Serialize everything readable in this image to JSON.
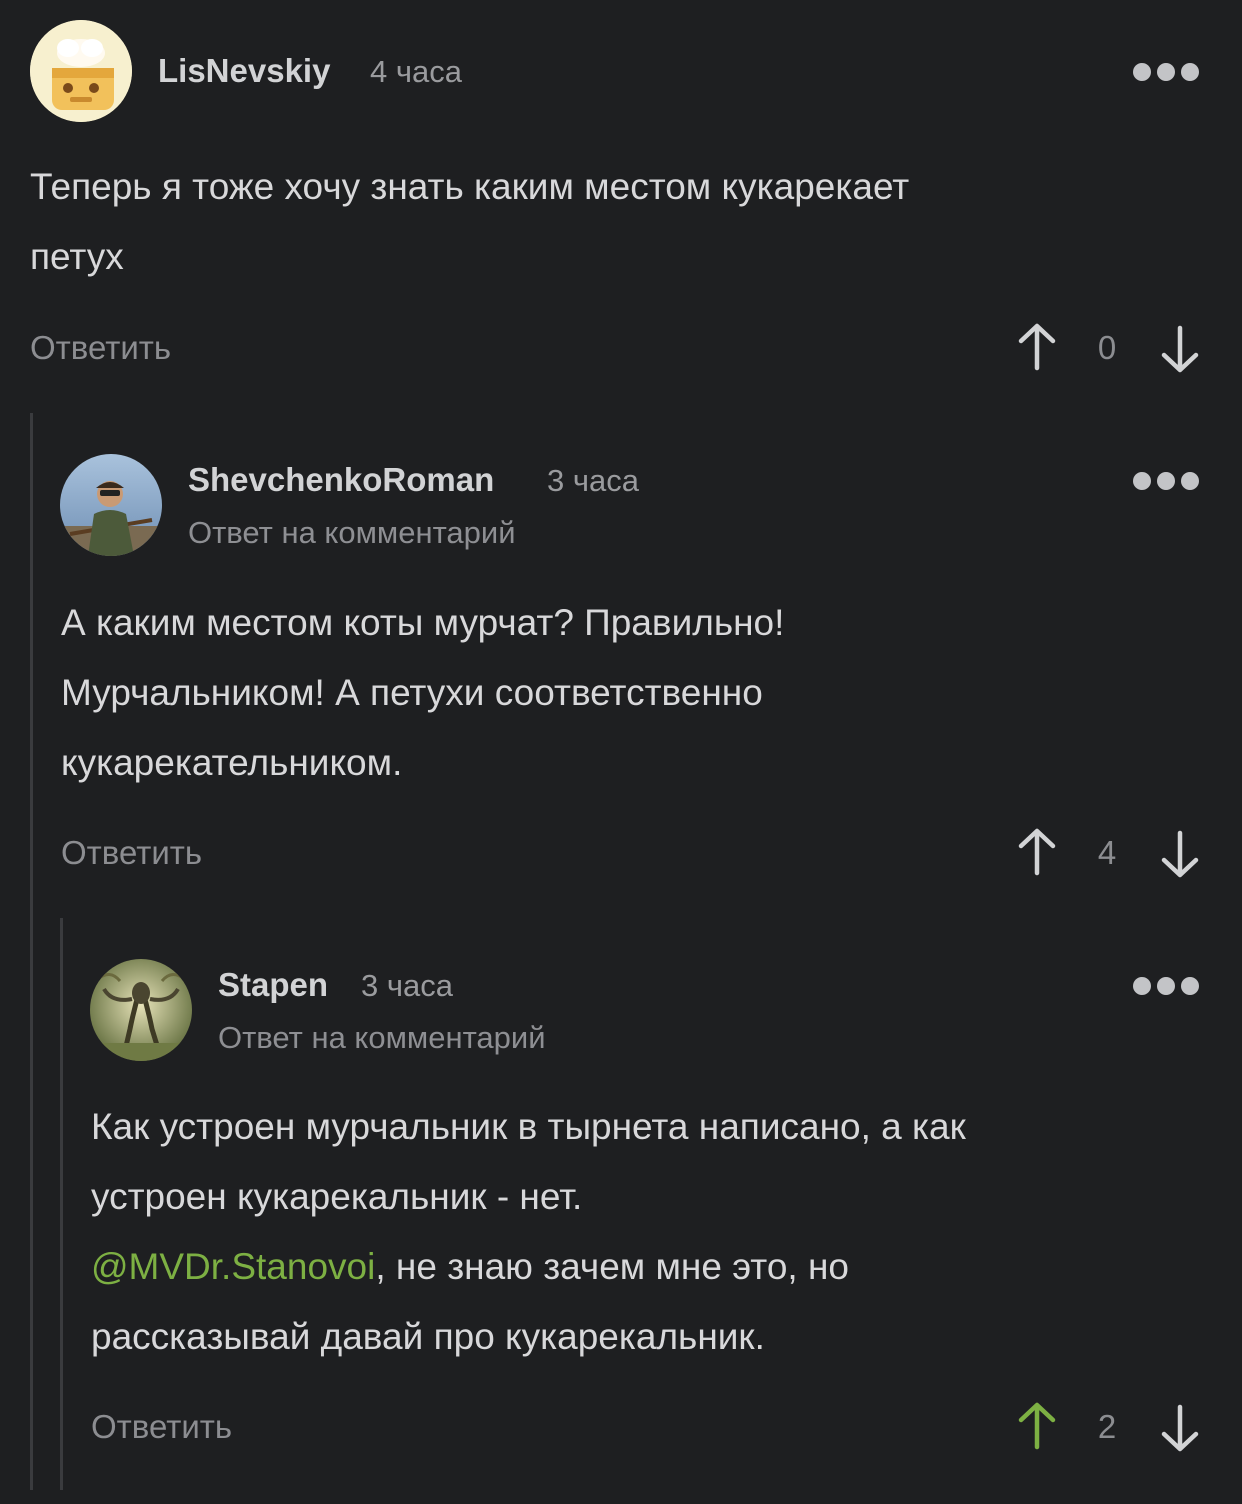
{
  "comments": [
    {
      "username": "LisNevskiy",
      "time": "4 часа",
      "reply_to": "",
      "body_line1": "Теперь я тоже хочу знать каким местом кукарекает",
      "body_line2": "петух",
      "reply_label": "Ответить",
      "votes": "0",
      "upvoted": false
    },
    {
      "username": "ShevchenkoRoman",
      "time": "3 часа",
      "reply_to": "Ответ на комментарий",
      "body_line1": "А каким местом коты мурчат? Правильно!",
      "body_line2": "Мурчальником! А петухи соответственно",
      "body_line3": "кукарекательником.",
      "reply_label": "Ответить",
      "votes": "4",
      "upvoted": false
    },
    {
      "username": "Stapen",
      "time": "3 часа",
      "reply_to": "Ответ на комментарий",
      "body_line1": "Как устроен мурчальник в тырнета написано, а как",
      "body_line2": "устроен кукарекальник - нет.",
      "mention": "@MVDr.Stanovoi",
      "body_line3_rest": ", не знаю зачем мне это, но",
      "body_line4": "рассказывай давай про кукарекальник.",
      "reply_label": "Ответить",
      "votes": "2",
      "upvoted": true
    }
  ],
  "colors": {
    "background": "#1e1f21",
    "accent_green": "#7db043",
    "text": "#d8d8da",
    "muted": "#8c8d91"
  }
}
